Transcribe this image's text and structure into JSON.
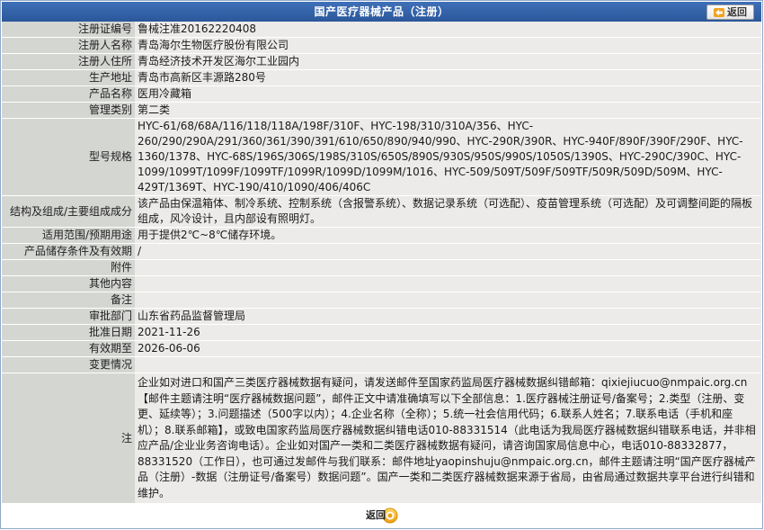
{
  "header": {
    "title": "国产医疗器械产品（注册）",
    "back_label": "返回"
  },
  "rows": [
    {
      "label": "注册证编号",
      "value": "鲁械注准20162220408"
    },
    {
      "label": "注册人名称",
      "value": "青岛海尔生物医疗股份有限公司"
    },
    {
      "label": "注册人住所",
      "value": "青岛经济技术开发区海尔工业园内"
    },
    {
      "label": "生产地址",
      "value": "青岛市高新区丰源路280号"
    },
    {
      "label": "产品名称",
      "value": "医用冷藏箱"
    },
    {
      "label": "管理类别",
      "value": "第二类"
    },
    {
      "label": "型号规格",
      "value": "HYC-61/68/68A/116/118/118A/198F/310F、HYC-198/310/310A/356、HYC-260/290/290A/291/360/361/390/391/610/650/890/940/990、HYC-290R/390R、HYC-940F/890F/390F/290F、HYC-1360/1378、HYC-68S/196S/306S/198S/310S/650S/890S/930S/950S/990S/1050S/1390S、HYC-290C/390C、HYC-1099/1099T/1099F/1099TF/1099R/1099D/1099M/1016、HYC-509/509T/509F/509TF/509R/509D/509M、HYC-429T/1369T、HYC-190/410/1090/406/406C"
    },
    {
      "label": "结构及组成/主要组成成分",
      "value": "该产品由保温箱体、制冷系统、控制系统（含报警系统）、数据记录系统（可选配）、疫苗管理系统（可选配）及可调整间距的隔板组成，风冷设计，且内部设有照明灯。"
    },
    {
      "label": "适用范围/预期用途",
      "value": "用于提供2℃~8℃储存环境。"
    },
    {
      "label": "产品储存条件及有效期",
      "value": "/"
    },
    {
      "label": "附件",
      "value": ""
    },
    {
      "label": "其他内容",
      "value": ""
    },
    {
      "label": "备注",
      "value": ""
    },
    {
      "label": "审批部门",
      "value": "山东省药品监督管理局"
    },
    {
      "label": "批准日期",
      "value": "2021-11-26"
    },
    {
      "label": "有效期至",
      "value": "2026-06-06"
    },
    {
      "label": "变更情况",
      "value": ""
    },
    {
      "label": "注",
      "value": "企业如对进口和国产三类医疗器械数据有疑问，请发送邮件至国家药监局医疗器械数据纠错邮箱：qixiejiucuo@nmpaic.org.cn【邮件主题请注明“医疗器械数据问题”，邮件正文中请准确填写以下全部信息：1.医疗器械注册证号/备案号；2.类型（注册、变更、延续等）；3.问题描述（500字以内）；4.企业名称（全称）；5.统一社会信用代码；6.联系人姓名；7.联系电话（手机和座机）；8.联系邮箱】，或致电国家药监局医疗器械数据纠错电话010-88331514（此电话为我局医疗器械数据纠错联系电话，并非相应产品/企业业务咨询电话）。企业如对国产一类和二类医疗器械数据有疑问，请咨询国家局信息中心，电话010-88332877，88331520（工作日），也可通过发邮件与我们联系：邮件地址yaopinshuju@nmpaic.org.cn，邮件主题请注明“国产医疗器械产品（注册）-数据（注册证号/备案号）数据问题”。国产一类和二类医疗器械数据来源于省局，由省局通过数据共享平台进行纠错和维护。"
    }
  ],
  "footer": {
    "back_label": "返回"
  },
  "colors": {
    "header_bg": "#2b579a",
    "label_bg": "#d4d6d2",
    "value_bg": "#ecebe9",
    "back_arrow": "#f2a31c"
  },
  "icons": [
    "back-arrow-icon",
    "back-oval-icon"
  ]
}
